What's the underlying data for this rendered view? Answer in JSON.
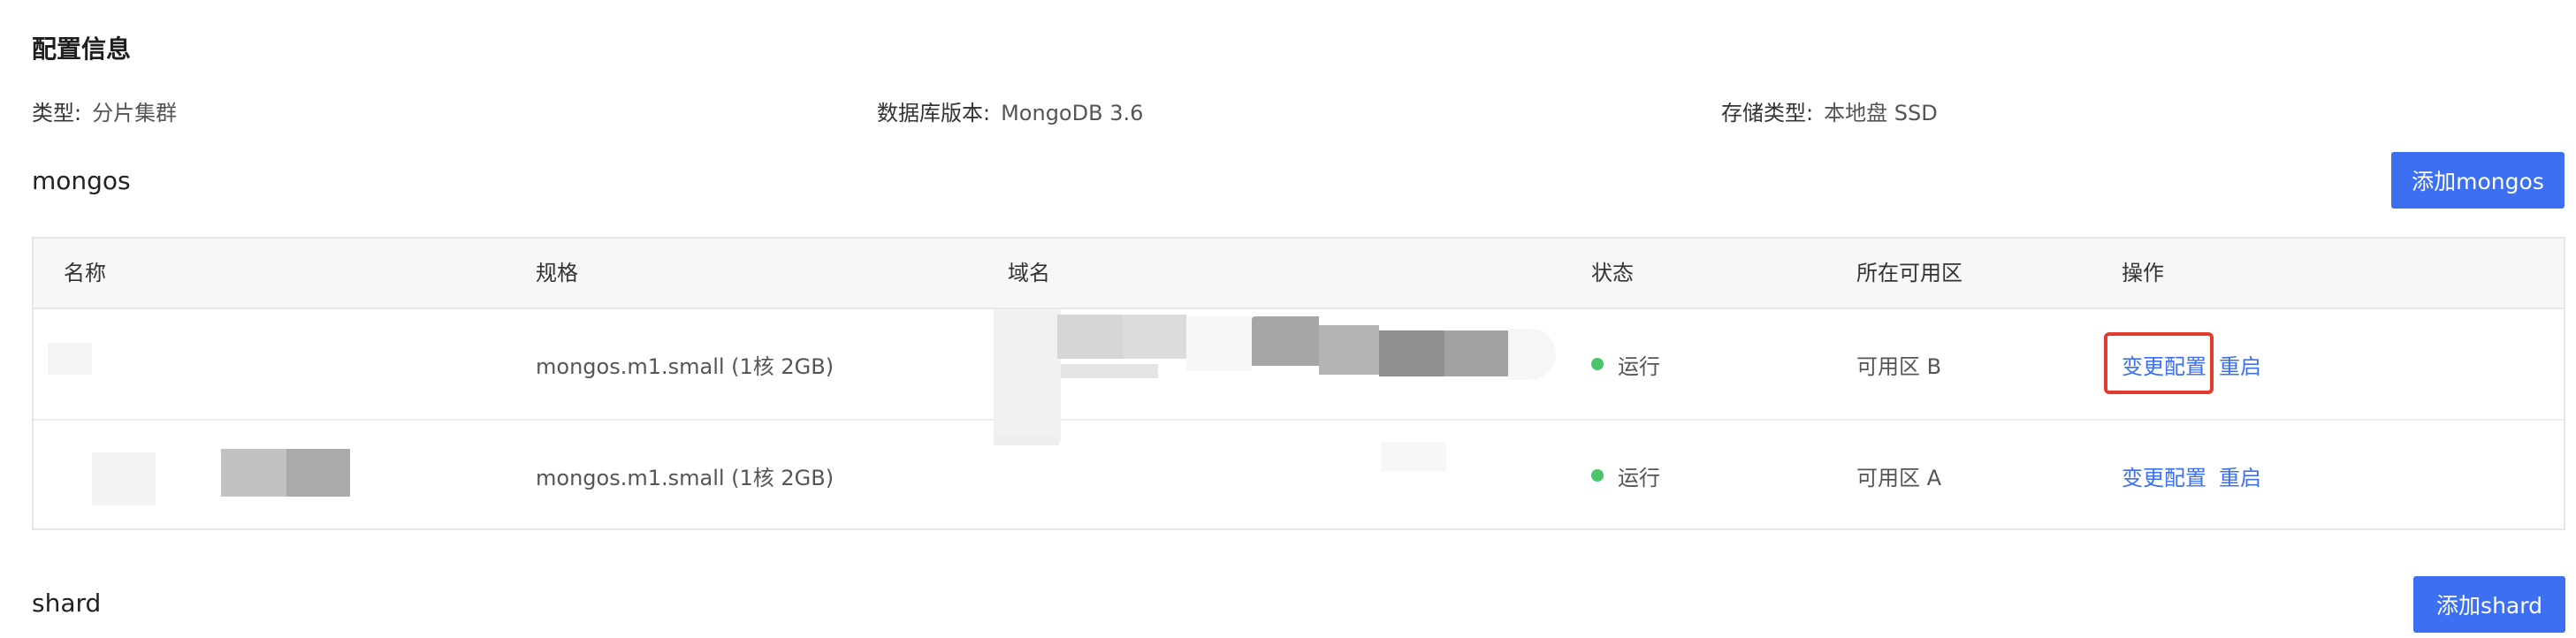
{
  "config": {
    "title": "配置信息",
    "type_label": "类型:",
    "type_value": "分片集群",
    "db_version_label": "数据库版本:",
    "db_version_value": "MongoDB 3.6",
    "storage_label": "存储类型:",
    "storage_value": "本地盘 SSD"
  },
  "mongos": {
    "title": "mongos",
    "add_button": "添加mongos",
    "columns": [
      "名称",
      "规格",
      "域名",
      "状态",
      "所在可用区",
      "操作"
    ],
    "rows": [
      {
        "name": "",
        "spec": "mongos.m1.small (1核 2GB)",
        "domain": "",
        "status": "运行",
        "zone": "可用区 B",
        "action_modify": "变更配置",
        "action_restart": "重启"
      },
      {
        "name": "",
        "spec": "mongos.m1.small (1核 2GB)",
        "domain": "",
        "status": "运行",
        "zone": "可用区 A",
        "action_modify": "变更配置",
        "action_restart": "重启"
      }
    ]
  },
  "shard": {
    "title": "shard",
    "add_button": "添加shard"
  },
  "colors": {
    "primary": "#3c6ff2",
    "status_running": "#4cc46b",
    "highlight": "#e23b2a"
  }
}
